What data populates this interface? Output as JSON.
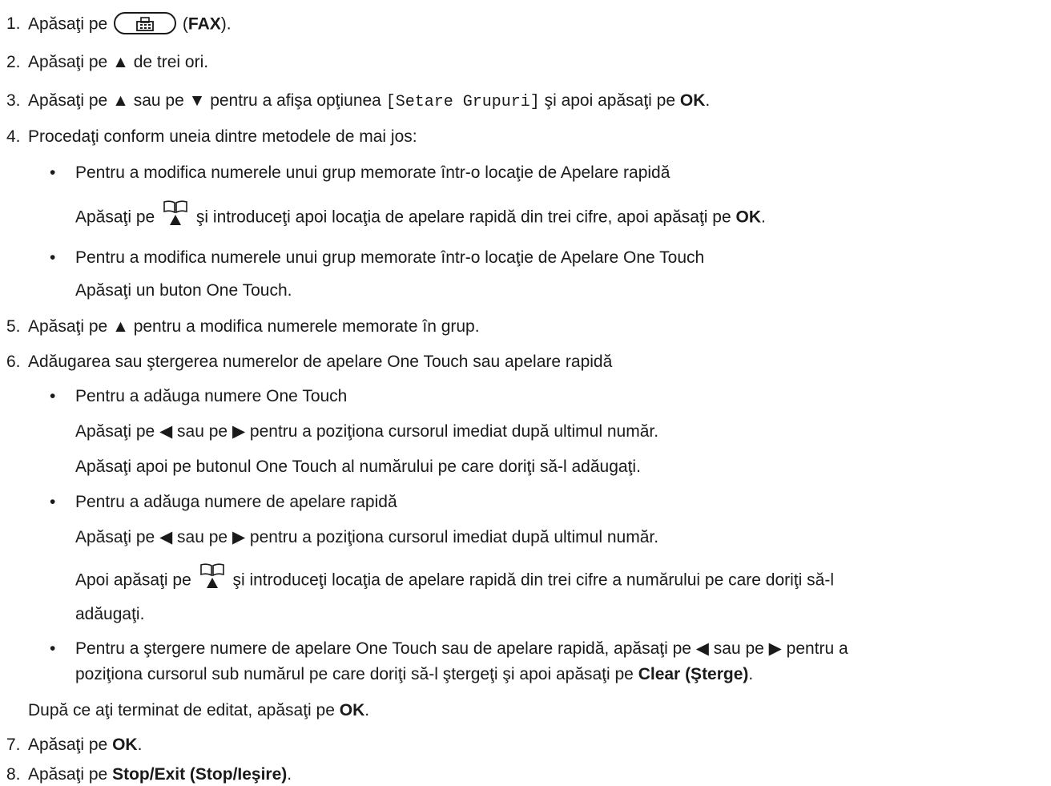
{
  "steps": {
    "s1": {
      "num": "1.",
      "pre": "Apăsaţi pe",
      "post_open": " (",
      "bold": "FAX",
      "post": ")."
    },
    "s2": {
      "num": "2.",
      "text": "Apăsaţi pe ▲ de trei ori."
    },
    "s3": {
      "num": "3.",
      "pre": "Apăsaţi pe ▲ sau pe ▼ pentru a afişa opţiunea ",
      "mono": "[Setare Grupuri]",
      "mid": " şi apoi apăsaţi pe ",
      "bold": "OK",
      "post": "."
    },
    "s4": {
      "num": "4.",
      "text": "Procedaţi conform uneia dintre metodele de mai jos:"
    },
    "s4a": {
      "bullet": "•",
      "text": "Pentru a modifica numerele unui grup memorate într-o locaţie de Apelare rapidă"
    },
    "s4a_detail": {
      "pre": "Apăsaţi pe ",
      "mid": " şi introduceţi apoi locaţia de apelare rapidă din trei cifre, apoi apăsaţi pe ",
      "bold": "OK",
      "post": "."
    },
    "s4b": {
      "bullet": "•",
      "text": "Pentru a modifica numerele unui grup memorate într-o locaţie de Apelare One Touch"
    },
    "s4b_detail": {
      "text": "Apăsaţi un buton One Touch."
    },
    "s5": {
      "num": "5.",
      "text": "Apăsaţi pe ▲ pentru a modifica numerele memorate în grup."
    },
    "s6": {
      "num": "6.",
      "text": "Adăugarea sau ştergerea numerelor de apelare One Touch sau apelare rapidă"
    },
    "s6a": {
      "bullet": "•",
      "text": "Pentru a adăuga numere One Touch"
    },
    "s6a_l1": {
      "text": "Apăsaţi pe ◀ sau pe ▶ pentru a poziţiona cursorul imediat după ultimul număr."
    },
    "s6a_l2": {
      "text": "Apăsaţi apoi pe butonul One Touch al numărului pe care doriţi să-l adăugaţi."
    },
    "s6b": {
      "bullet": "•",
      "text": "Pentru a adăuga numere de apelare rapidă"
    },
    "s6b_l1": {
      "text": "Apăsaţi pe ◀ sau pe ▶ pentru a poziţiona cursorul imediat după ultimul număr."
    },
    "s6b_l2": {
      "pre": "Apoi apăsaţi pe ",
      "post": " şi introduceţi locaţia de apelare rapidă din trei cifre a numărului pe care doriţi să-l"
    },
    "s6b_l3": {
      "text": "adăugaţi."
    },
    "s6c": {
      "bullet": "•",
      "text": "Pentru a ştergere numere de apelare One Touch sau de apelare rapidă, apăsaţi pe ◀ sau pe ▶ pentru a"
    },
    "s6c_l2": {
      "pre": "poziţiona cursorul sub numărul pe care doriţi să-l ştergeţi şi apoi apăsaţi pe ",
      "bold": "Clear (Şterge)",
      "post": "."
    },
    "s6_after": {
      "pre": "După ce aţi terminat de editat, apăsaţi pe ",
      "bold": "OK",
      "post": "."
    },
    "s7": {
      "num": "7.",
      "pre": "Apăsaţi pe ",
      "bold": "OK",
      "post": "."
    },
    "s8": {
      "num": "8.",
      "pre": "Apăsaţi pe ",
      "bold": "Stop/Exit (Stop/Ieşire)",
      "post": "."
    }
  },
  "icons": {
    "fax_button": "fax-icon",
    "address_book": "address-book-icon"
  }
}
